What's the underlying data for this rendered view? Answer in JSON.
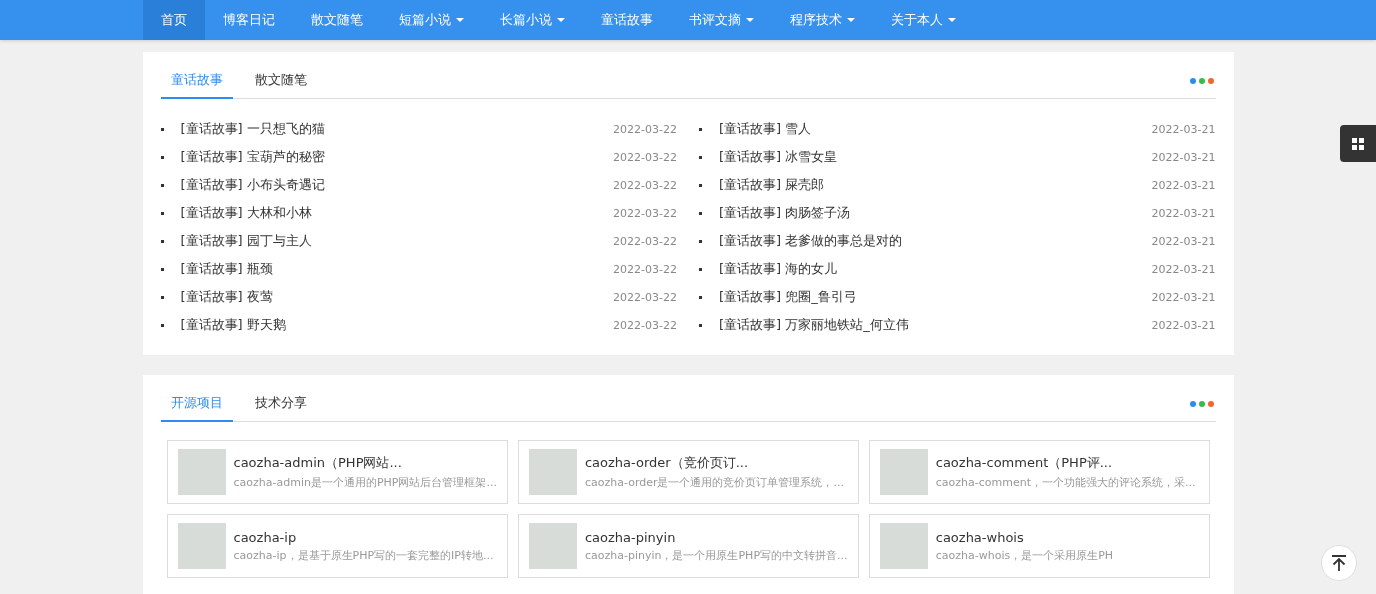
{
  "nav": {
    "items": [
      {
        "label": "首页",
        "selected": true,
        "dropdown": false
      },
      {
        "label": "博客日记",
        "selected": false,
        "dropdown": false
      },
      {
        "label": "散文随笔",
        "selected": false,
        "dropdown": false
      },
      {
        "label": "短篇小说",
        "selected": false,
        "dropdown": true
      },
      {
        "label": "长篇小说",
        "selected": false,
        "dropdown": true
      },
      {
        "label": "童话故事",
        "selected": false,
        "dropdown": false
      },
      {
        "label": "书评文摘",
        "selected": false,
        "dropdown": true
      },
      {
        "label": "程序技术",
        "selected": false,
        "dropdown": true
      },
      {
        "label": "关于本人",
        "selected": false,
        "dropdown": true
      }
    ]
  },
  "panels": [
    {
      "kind": "list",
      "tabs": [
        {
          "label": "童话故事",
          "selected": true
        },
        {
          "label": "散文随笔",
          "selected": false
        }
      ],
      "columns": [
        [
          {
            "title": "[童话故事] 一只想飞的猫",
            "date": "2022-03-22"
          },
          {
            "title": "[童话故事] 宝葫芦的秘密",
            "date": "2022-03-22"
          },
          {
            "title": "[童话故事] 小布头奇遇记",
            "date": "2022-03-22"
          },
          {
            "title": "[童话故事] 大林和小林",
            "date": "2022-03-22"
          },
          {
            "title": "[童话故事] 园丁与主人",
            "date": "2022-03-22"
          },
          {
            "title": "[童话故事] 瓶颈",
            "date": "2022-03-22"
          },
          {
            "title": "[童话故事] 夜莺",
            "date": "2022-03-22"
          },
          {
            "title": "[童话故事] 野天鹅",
            "date": "2022-03-22"
          }
        ],
        [
          {
            "title": "[童话故事] 雪人",
            "date": "2022-03-21"
          },
          {
            "title": "[童话故事] 冰雪女皇",
            "date": "2022-03-21"
          },
          {
            "title": "[童话故事] 屎壳郎",
            "date": "2022-03-21"
          },
          {
            "title": "[童话故事] 肉肠签子汤",
            "date": "2022-03-21"
          },
          {
            "title": "[童话故事] 老爹做的事总是对的",
            "date": "2022-03-21"
          },
          {
            "title": "[童话故事] 海的女儿",
            "date": "2022-03-21"
          },
          {
            "title": "[童话故事] 兜圈_鲁引弓",
            "date": "2022-03-21"
          },
          {
            "title": "[童话故事] 万家丽地铁站_何立伟",
            "date": "2022-03-21"
          }
        ]
      ]
    },
    {
      "kind": "cards",
      "tabs": [
        {
          "label": "开源项目",
          "selected": true
        },
        {
          "label": "技术分享",
          "selected": false
        }
      ],
      "cards": [
        {
          "title": "caozha-admin（PHP网站...",
          "description": "caozha-admin是一个通用的PHP网站后台管理框架..."
        },
        {
          "title": "caozha-order（竞价页订...",
          "description": "caozha-order是一个通用的竞价页订单管理系统，..."
        },
        {
          "title": "caozha-comment（PHP评...",
          "description": "caozha-comment，一个功能强大的评论系统，采..."
        },
        {
          "title": "caozha-ip",
          "description": "caozha-ip，是基于原生PHP写的一套完整的IP转地..."
        },
        {
          "title": "caozha-pinyin",
          "description": "caozha-pinyin，是一个用原生PHP写的中文转拼音..."
        },
        {
          "title": "caozha-whois",
          "description": "caozha-whois，是一个采用原生PH"
        }
      ]
    }
  ]
}
